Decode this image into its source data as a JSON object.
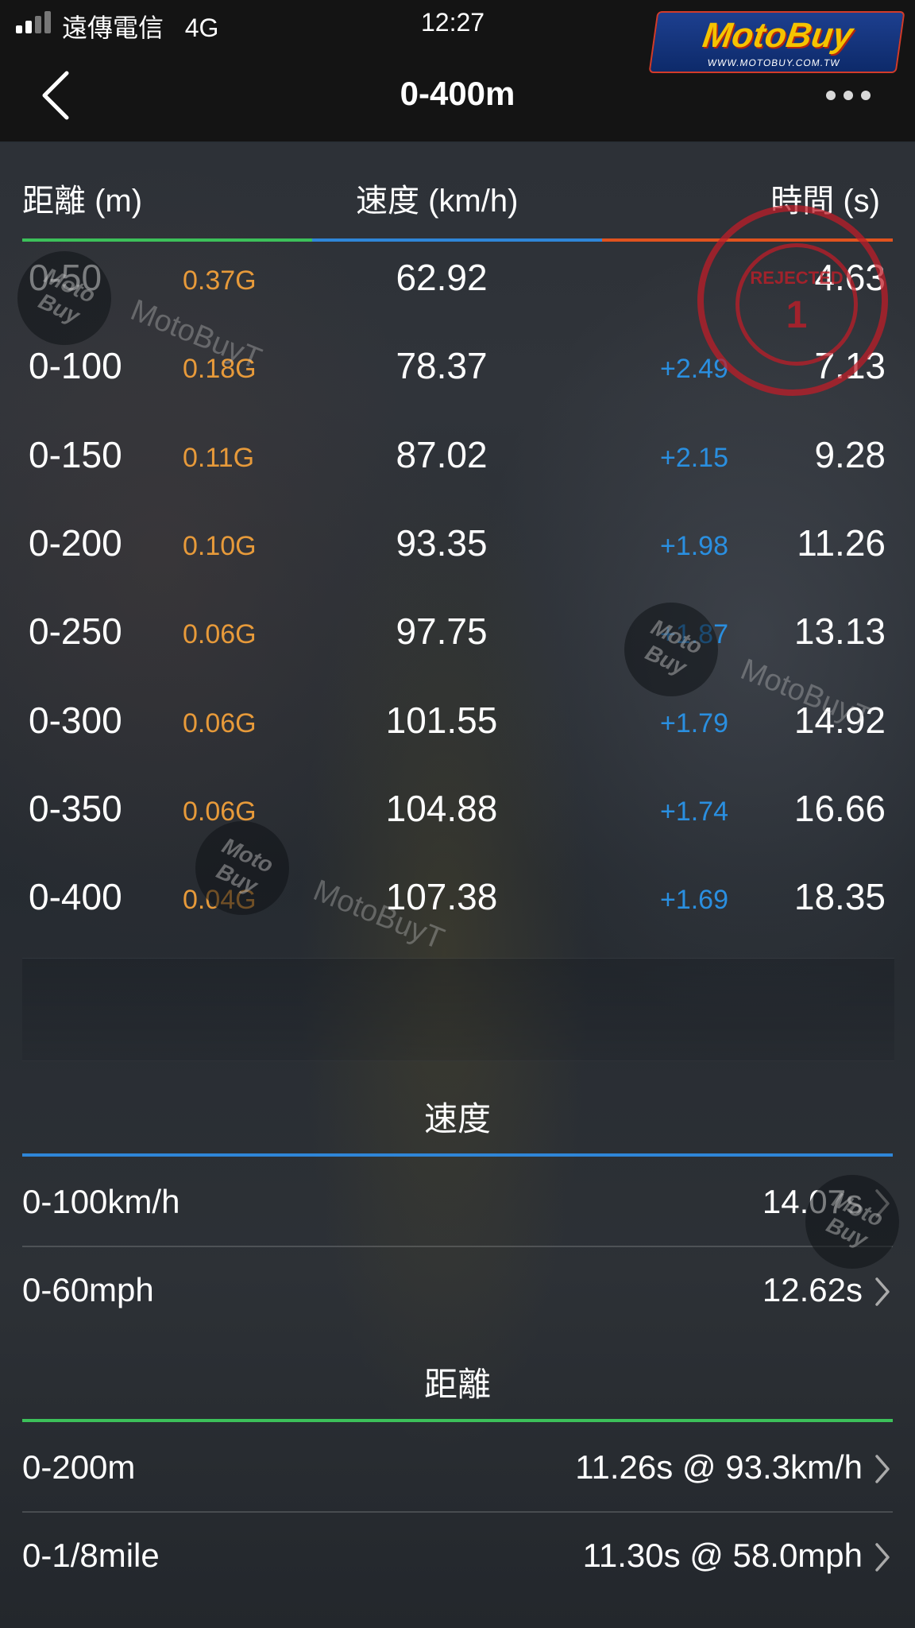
{
  "status_bar": {
    "carrier": "遠傳電信",
    "network": "4G",
    "time": "12:27"
  },
  "watermark": {
    "logo": "MotoBuy",
    "logo_url": "WWW.MOTOBUY.COM.TW",
    "text": "MotoBuyT",
    "badge": "Moto Buy"
  },
  "stamp": {
    "text": "REJECTED",
    "number": "1"
  },
  "nav": {
    "title": "0-400m",
    "back_icon": "chevron-left-icon",
    "more_icon": "more-dots-icon"
  },
  "table": {
    "headers": {
      "distance": "距離 (m)",
      "speed": "速度 (km/h)",
      "time": "時間 (s)"
    },
    "rule_colors": [
      "#3cc15a",
      "#2f86d8",
      "#e0531e"
    ],
    "rows": [
      {
        "distance": "0-50",
        "g": "0.37G",
        "speed": "62.92",
        "delta": "",
        "time": "4.63"
      },
      {
        "distance": "0-100",
        "g": "0.18G",
        "speed": "78.37",
        "delta": "+2.49",
        "time": "7.13"
      },
      {
        "distance": "0-150",
        "g": "0.11G",
        "speed": "87.02",
        "delta": "+2.15",
        "time": "9.28"
      },
      {
        "distance": "0-200",
        "g": "0.10G",
        "speed": "93.35",
        "delta": "+1.98",
        "time": "11.26"
      },
      {
        "distance": "0-250",
        "g": "0.06G",
        "speed": "97.75",
        "delta": "+1.87",
        "time": "13.13"
      },
      {
        "distance": "0-300",
        "g": "0.06G",
        "speed": "101.55",
        "delta": "+1.79",
        "time": "14.92"
      },
      {
        "distance": "0-350",
        "g": "0.06G",
        "speed": "104.88",
        "delta": "+1.74",
        "time": "16.66"
      },
      {
        "distance": "0-400",
        "g": "0.04G",
        "speed": "107.38",
        "delta": "+1.69",
        "time": "18.35"
      }
    ]
  },
  "speed_section": {
    "title": "速度",
    "rule_color": "#2f86d8",
    "items": [
      {
        "label": "0-100km/h",
        "value": "14.07s"
      },
      {
        "label": "0-60mph",
        "value": "12.62s"
      }
    ]
  },
  "distance_section": {
    "title": "距離",
    "rule_color": "#3cc15a",
    "items": [
      {
        "label": "0-200m",
        "value": "11.26s @ 93.3km/h"
      },
      {
        "label": "0-1/8mile",
        "value": "11.30s @ 58.0mph"
      }
    ]
  }
}
